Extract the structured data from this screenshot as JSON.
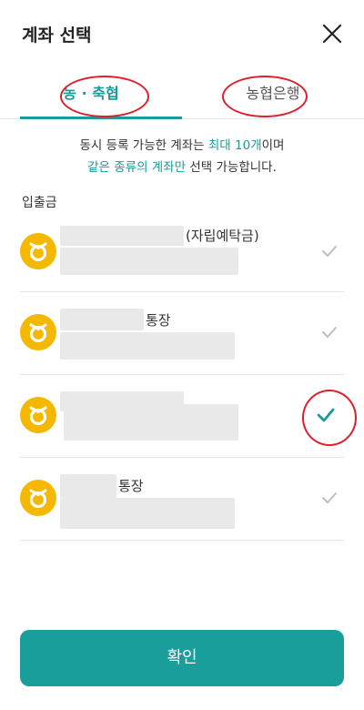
{
  "header": {
    "title": "계좌 선택",
    "close_icon": "close-icon"
  },
  "tabs": [
    {
      "label": "농 · 축협",
      "active": true
    },
    {
      "label": "농협은행",
      "active": false
    }
  ],
  "notice": {
    "line1_prefix": "동시 등록 가능한 계좌는 ",
    "line1_highlight": "최대 10개",
    "line1_suffix": "이며",
    "line2_highlight": "같은 종류의 계좌만",
    "line2_suffix": " 선택 가능합니다."
  },
  "section": {
    "label": "입출금"
  },
  "accounts": [
    {
      "name_suffix": "(자립예탁금)",
      "selected": false,
      "icon": "nh-bank-logo-icon"
    },
    {
      "name_suffix": "통장",
      "selected": false,
      "icon": "nh-bank-logo-icon"
    },
    {
      "name_suffix": "",
      "selected": true,
      "icon": "nh-bank-logo-icon"
    },
    {
      "name_suffix": "통장",
      "selected": false,
      "icon": "nh-bank-logo-icon"
    }
  ],
  "footer": {
    "confirm_label": "확인"
  },
  "colors": {
    "accent": "#1a9a9a",
    "button": "#1a9e9c",
    "logo": "#f5b800",
    "annotation": "#e01e2a"
  }
}
